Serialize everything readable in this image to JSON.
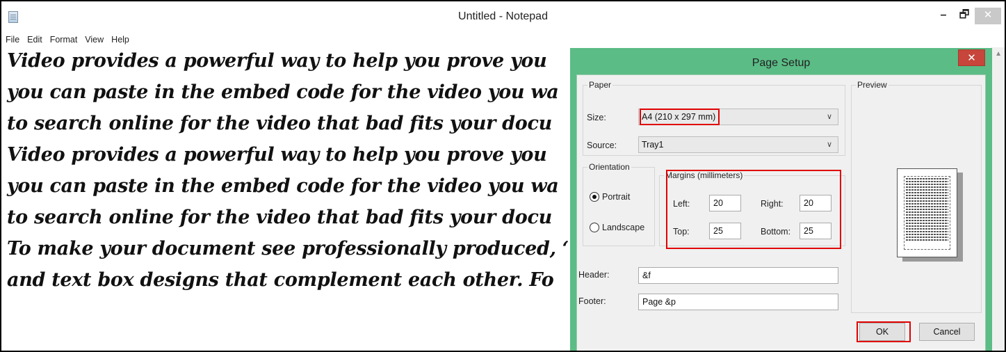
{
  "window": {
    "title": "Untitled - Notepad",
    "minimize_glyph": "–",
    "maximize_glyph": "🗗",
    "close_glyph": "✕"
  },
  "menu": [
    "File",
    "Edit",
    "Format",
    "View",
    "Help"
  ],
  "document": {
    "lines": [
      "Video provides a powerful way to help you prove you",
      "you can paste in the embed code for the video you wa",
      "to search online for the video that bad fits your docu",
      "Video provides a powerful way to help you prove you",
      "you can paste in the embed code for the video you wa",
      "to search online for the video that bad fits your docu",
      "To make your document see professionally produced, ‘",
      "and text box designs that complement each other. Fo"
    ]
  },
  "dialog": {
    "title": "Page Setup",
    "close_glyph": "✕",
    "paper": {
      "group_label": "Paper",
      "size_label": "Size:",
      "size_value": "A4 (210 x 297 mm)",
      "source_label": "Source:",
      "source_value": "Tray1"
    },
    "orientation": {
      "group_label": "Orientation",
      "portrait_label": "Portrait",
      "landscape_label": "Landscape",
      "selected": "Portrait"
    },
    "margins": {
      "group_label": "Margins (millimeters)",
      "left_label": "Left:",
      "left_value": "20",
      "right_label": "Right:",
      "right_value": "20",
      "top_label": "Top:",
      "top_value": "25",
      "bottom_label": "Bottom:",
      "bottom_value": "25"
    },
    "preview_label": "Preview",
    "header_label": "Header:",
    "header_value": "&f",
    "footer_label": "Footer:",
    "footer_value": "Page &p",
    "ok_label": "OK",
    "cancel_label": "Cancel",
    "chevron_glyph": "∨",
    "highlight_color": "#e00000",
    "accent_color": "#5bbc86"
  }
}
